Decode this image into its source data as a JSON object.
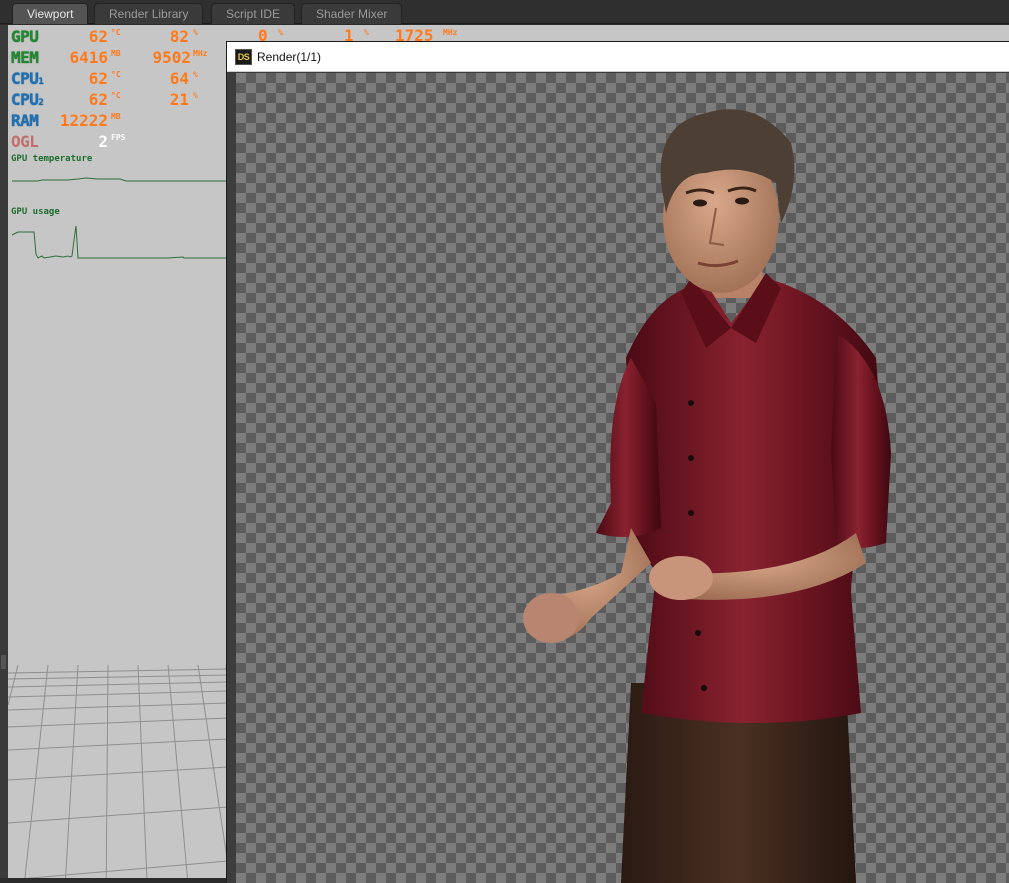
{
  "tabs": [
    {
      "label": "Viewport",
      "active": true
    },
    {
      "label": "Render Library",
      "active": false
    },
    {
      "label": "Script IDE",
      "active": false
    },
    {
      "label": "Shader Mixer",
      "active": false
    }
  ],
  "hud": {
    "gpu": {
      "label": "GPU",
      "temp": "62",
      "temp_unit": "°C",
      "load": "82",
      "load_unit": "%"
    },
    "mem": {
      "label": "MEM",
      "used": "6416",
      "used_unit": "MB",
      "clock": "9502",
      "clock_unit": "MHz"
    },
    "cpu1": {
      "label": "CPU",
      "sub": "1",
      "temp": "62",
      "temp_unit": "°C",
      "load": "64",
      "load_unit": "%"
    },
    "cpu2": {
      "label": "CPU",
      "sub": "2",
      "temp": "62",
      "temp_unit": "°C",
      "load": "21",
      "load_unit": "%"
    },
    "ram": {
      "label": "RAM",
      "used": "12222",
      "used_unit": "MB"
    },
    "ogl": {
      "label": "OGL",
      "fps": "2",
      "fps_unit": "FPS"
    },
    "graph_temp_title": "GPU temperature",
    "graph_usage_title": "GPU usage",
    "overflow": {
      "v1": "0",
      "u1": "%",
      "v2": "1",
      "u2": "%",
      "v3": "1725",
      "u3": "MHz"
    }
  },
  "render_window": {
    "title": "Render(1/1)",
    "logo": "DS"
  },
  "colors": {
    "hud_value": "#ff7a1c",
    "hud_green": "#1e8a2e",
    "hud_blue": "#1c72b8",
    "shirt": "#6e1420"
  }
}
